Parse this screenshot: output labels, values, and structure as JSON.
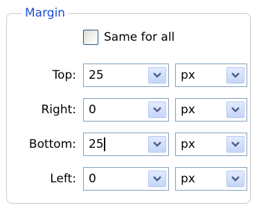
{
  "margin_panel": {
    "legend": "Margin",
    "same_for_all": {
      "label": "Same for all",
      "checked": false
    },
    "rows": [
      {
        "label": "Top:",
        "value": "25",
        "unit": "px"
      },
      {
        "label": "Right:",
        "value": "0",
        "unit": "px"
      },
      {
        "label": "Bottom:",
        "value": "25",
        "unit": "px",
        "focused": true
      },
      {
        "label": "Left:",
        "value": "0",
        "unit": "px"
      }
    ]
  },
  "colors": {
    "legend_text": "#1c4fd6",
    "field_border": "#7f9db9",
    "dropdown_button": "#c6d6fa",
    "arrow": "#4d6185"
  },
  "icons": {
    "dropdown": "chevron-down-icon"
  }
}
